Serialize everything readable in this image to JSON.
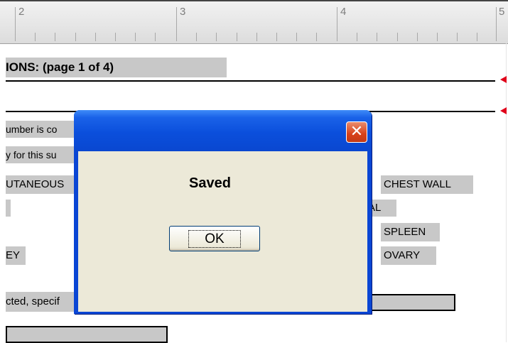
{
  "ruler": {
    "numbers": [
      "2",
      "3",
      "4",
      "5"
    ]
  },
  "document": {
    "heading": "IONS:  (page 1 of 4)",
    "line1": "umber is co",
    "line2": "y for this su",
    "field_cutaneous": "UTANEOUS",
    "field_ey": "EY",
    "field_chest_wall": "CHEST WALL",
    "field_al": "AL",
    "field_spleen": "SPLEEN",
    "field_ovary": "OVARY",
    "field_specify": "cted, specif"
  },
  "dialog": {
    "message": "Saved",
    "ok_label": "OK",
    "close_glyph": "✕"
  },
  "colors": {
    "titlebar": "#0a47d0",
    "dialog_body": "#ece9d8",
    "field_gray": "#c8c8c8",
    "close_red": "#d8411a",
    "marker_red": "#e0001a"
  }
}
